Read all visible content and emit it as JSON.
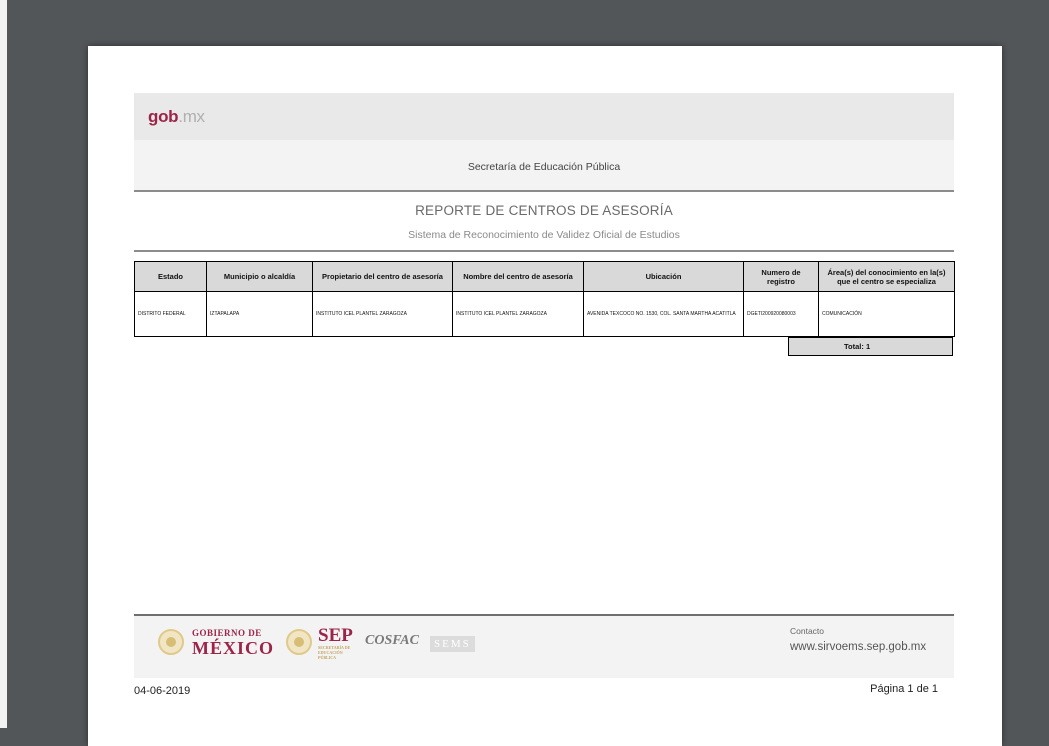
{
  "header": {
    "logo_gob": "gob",
    "logo_mx": ".mx",
    "secretaria": "Secretaría de Educación Pública"
  },
  "report": {
    "title": "REPORTE DE CENTROS DE ASESORÍA",
    "subtitle": "Sistema de Reconocimiento de Validez Oficial de Estudios"
  },
  "table": {
    "columns": [
      "Estado",
      "Municipio o alcaldía",
      "Propietario del centro de asesoría",
      "Nombre del centro de asesoría",
      "Ubicación",
      "Numero de registro",
      "Área(s) del conocimiento en la(s) que el centro se especializa"
    ],
    "rows": [
      [
        "DISTRITO FEDERAL",
        "IZTAPALAPA",
        "INSTITUTO ICEL PLANTEL ZARAGOZA",
        "INSTITUTO ICEL PLANTEL ZARAGOZA",
        "AVENIDA TEXCOCO NO. 1530, COL. SANTA MARTHA ACATITLA",
        "DGETI200920080003",
        "COMUNICACIÓN"
      ]
    ],
    "total": "Total:  1"
  },
  "footer": {
    "gobierno_line1": "GOBIERNO DE",
    "gobierno_line2": "MÉXICO",
    "sep": "SEP",
    "sep_small": "SECRETARÍA DE EDUCACIÓN PÚBLICA",
    "cosfac": "COSFAC",
    "sems": "SEMS",
    "contacto_label": "Contacto",
    "contacto_url": "www.sirvoems.sep.gob.mx",
    "date": "04-06-2019",
    "page": "Página 1 de 1"
  }
}
